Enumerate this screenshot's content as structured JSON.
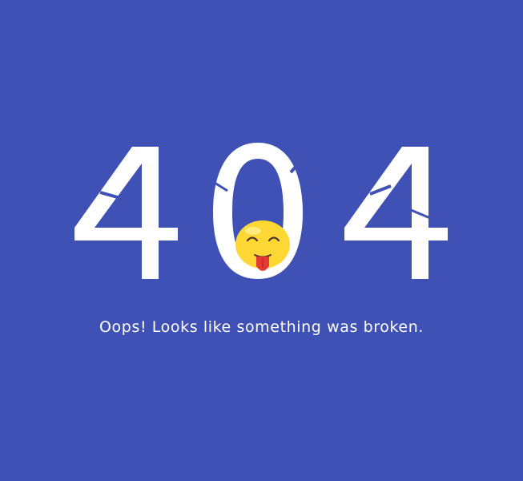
{
  "error": {
    "code_digits": [
      "4",
      "0",
      "4"
    ],
    "message": "Oops! Looks like something was broken.",
    "mascot_icon": "tongue-out-smiley-icon"
  },
  "colors": {
    "background": "#3f51b5",
    "text": "#ffffff",
    "mascot_face": "#fdd835",
    "mascot_tongue": "#e53935"
  }
}
